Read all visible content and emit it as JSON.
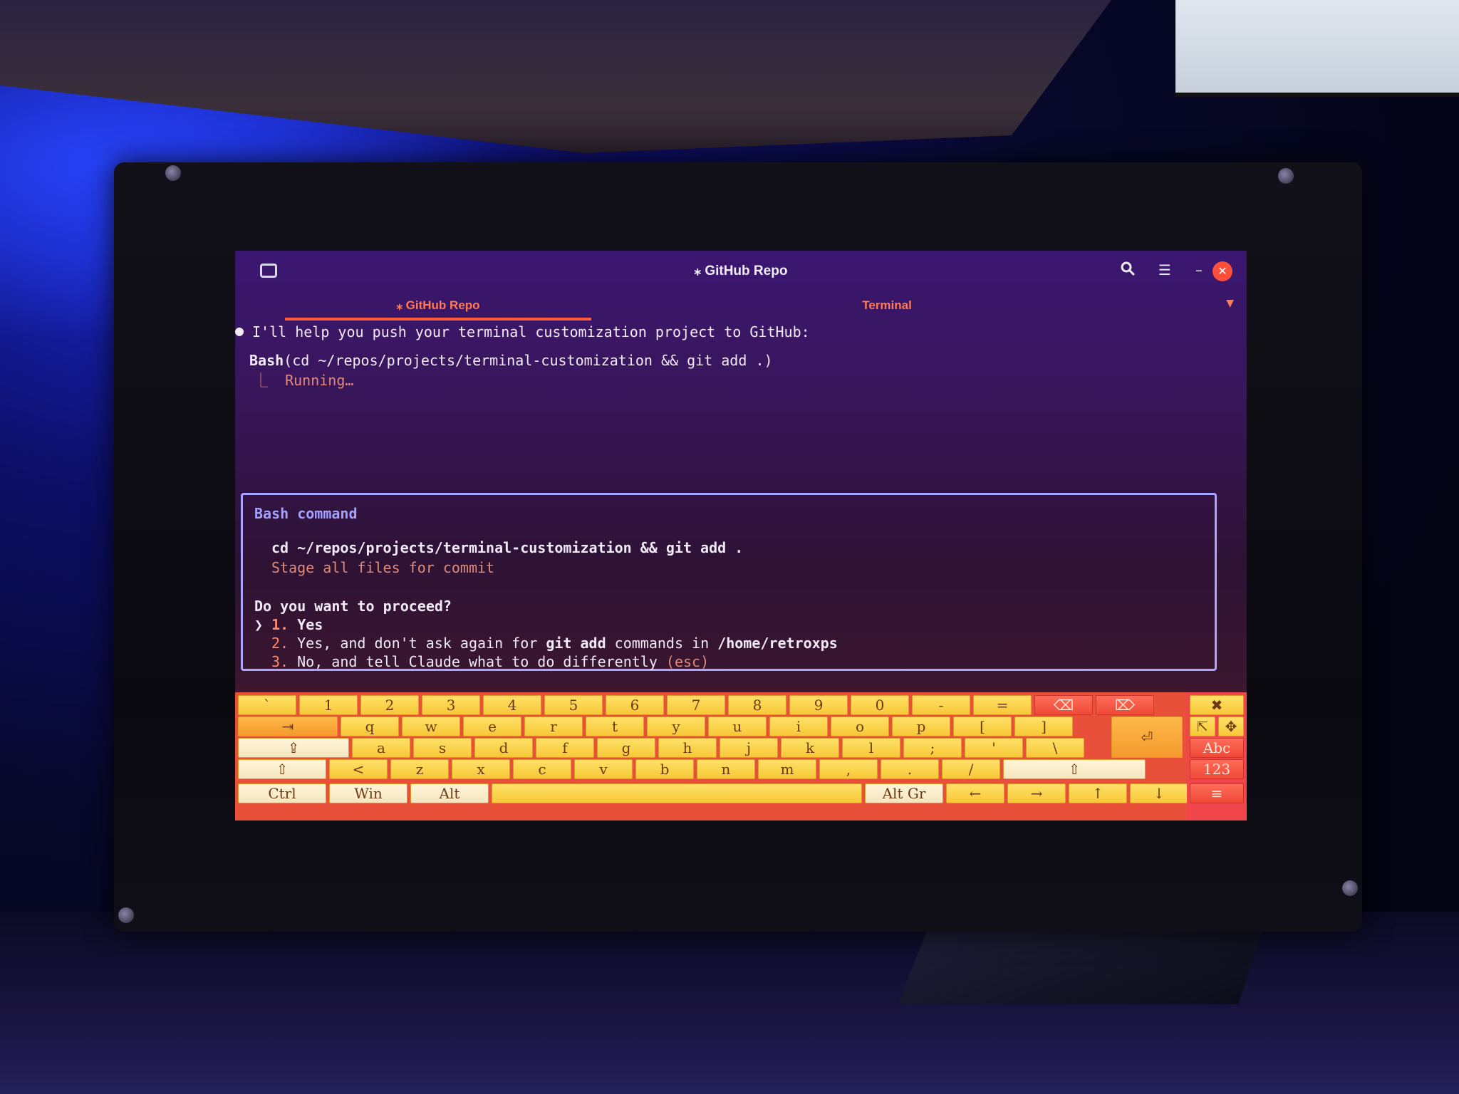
{
  "window": {
    "title": "⁎ GitHub Repo"
  },
  "tabs": [
    {
      "label": "⁎ GitHub Repo",
      "active": true
    },
    {
      "label": "Terminal",
      "active": false
    }
  ],
  "terminal": {
    "intro": "I'll help you push your terminal customization project to GitHub:",
    "bash_call_prefix": "Bash",
    "bash_call_args": "(cd ~/repos/projects/terminal-customization && git add .)",
    "running": "⎿  Running…",
    "box_title": "Bash command",
    "command": "cd ~/repos/projects/terminal-customization && git add .",
    "command_description": "Stage all files for commit",
    "question": "Do you want to proceed?",
    "options": [
      {
        "num": "1.",
        "text": "Yes",
        "selected": true
      },
      {
        "num": "2.",
        "text_a": "Yes, and don't ask again for ",
        "bold_a": "git add",
        "text_b": " commands in ",
        "bold_b": "/home/retroxps"
      },
      {
        "num": "3.",
        "text_a": "No, and tell Claude what to do differently ",
        "hint": "(esc)"
      }
    ],
    "selector": "❯"
  },
  "keyboard": {
    "row1": [
      "`",
      "1",
      "2",
      "3",
      "4",
      "5",
      "6",
      "7",
      "8",
      "9",
      "0",
      "-",
      "=",
      "⌫",
      "⌦"
    ],
    "row2": [
      "⇥",
      "q",
      "w",
      "e",
      "r",
      "t",
      "y",
      "u",
      "i",
      "o",
      "p",
      "[",
      "]"
    ],
    "row3": [
      "⇪",
      "a",
      "s",
      "d",
      "f",
      "g",
      "h",
      "j",
      "k",
      "l",
      ";",
      "'",
      "\\"
    ],
    "row4": [
      "⇧",
      "<",
      "z",
      "x",
      "c",
      "v",
      "b",
      "n",
      "m",
      ",",
      ".",
      "/",
      "⇧"
    ],
    "row5": [
      "Ctrl",
      "Win",
      "Alt",
      "",
      "Alt Gr",
      "←",
      "→",
      "↑",
      "↓"
    ],
    "enter": "⏎",
    "side": {
      "close": "✖",
      "pointer": "⇱",
      "move": "✥",
      "abc": "Abc",
      "num": "123",
      "menu": "≡"
    }
  },
  "colors": {
    "accent": "#ff5a3a",
    "box_border": "#a9a6ff",
    "key": "#f7c838",
    "key_light": "#f4e6bf"
  }
}
